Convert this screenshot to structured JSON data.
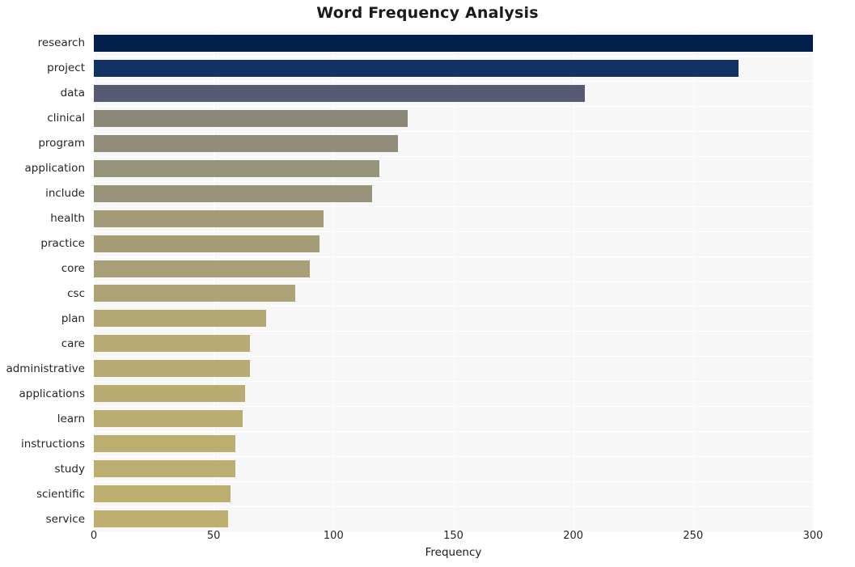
{
  "chart_data": {
    "type": "bar",
    "orientation": "horizontal",
    "title": "Word Frequency Analysis",
    "xlabel": "Frequency",
    "ylabel": "",
    "categories": [
      "research",
      "project",
      "data",
      "clinical",
      "program",
      "application",
      "include",
      "health",
      "practice",
      "core",
      "csc",
      "plan",
      "care",
      "administrative",
      "applications",
      "learn",
      "instructions",
      "study",
      "scientific",
      "service"
    ],
    "values": [
      300,
      269,
      205,
      131,
      127,
      119,
      116,
      96,
      94,
      90,
      84,
      72,
      65,
      65,
      63,
      62,
      59,
      59,
      57,
      56
    ],
    "bar_colors": [
      "#03204c",
      "#113263",
      "#565a73",
      "#8c8878",
      "#918d79",
      "#97927a",
      "#98937a",
      "#a39b78",
      "#a69d78",
      "#a89f78",
      "#ad a376",
      "#b3a874",
      "#b7ab73",
      "#b7ab73",
      "#b8ac72",
      "#b9ad72",
      "#bbae71",
      "#bbae71",
      "#bcaf70",
      "#bcaf70"
    ],
    "xlim": [
      0,
      300
    ],
    "xticks": [
      0,
      50,
      100,
      150,
      200,
      250,
      300
    ],
    "xtick_labels": [
      "0",
      "50",
      "100",
      "150",
      "200",
      "250",
      "300"
    ],
    "grid": true,
    "grid_color": "#ffffff",
    "plot_background": "#f7f7f7",
    "figure_background": "#ffffff",
    "legend": null,
    "colormap": "cividis"
  }
}
